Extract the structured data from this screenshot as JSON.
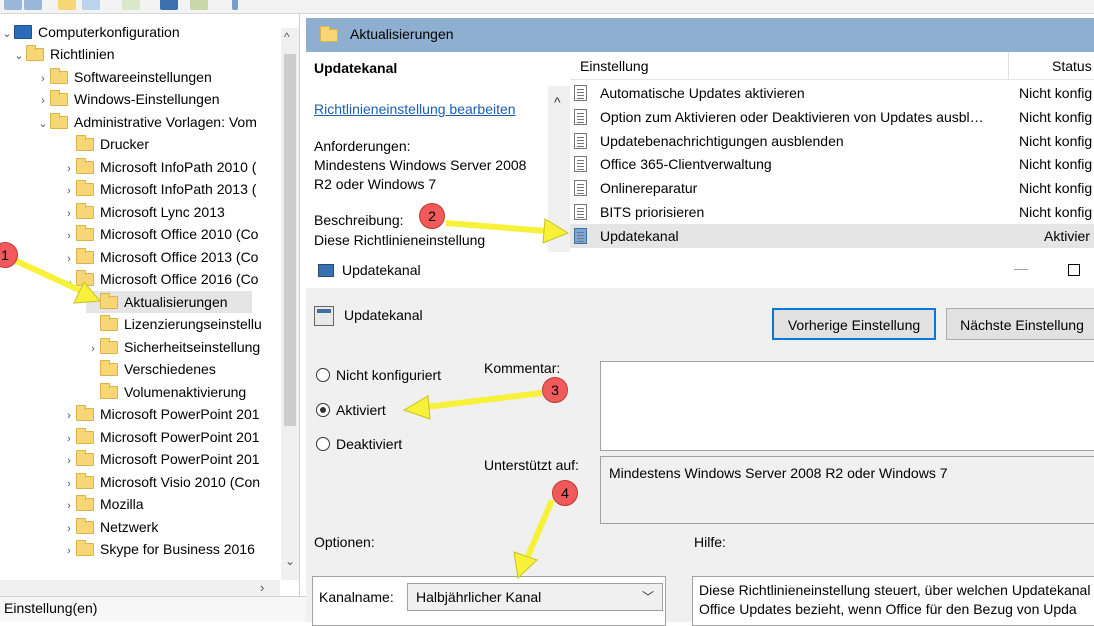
{
  "tree": {
    "items": [
      {
        "label": "Computerkonfiguration",
        "chev": "⌄"
      },
      {
        "label": "Richtlinien",
        "chev": "⌄"
      },
      {
        "label": "Softwareeinstellungen",
        "chev": "›"
      },
      {
        "label": "Windows-Einstellungen",
        "chev": "›"
      },
      {
        "label": "Administrative Vorlagen: Vom",
        "chev": "⌄"
      },
      {
        "label": "Drucker",
        "chev": ""
      },
      {
        "label": "Microsoft InfoPath 2010 (",
        "chev": "›"
      },
      {
        "label": "Microsoft InfoPath 2013 (",
        "chev": "›"
      },
      {
        "label": "Microsoft Lync 2013",
        "chev": "›"
      },
      {
        "label": "Microsoft Office 2010 (Co",
        "chev": "›"
      },
      {
        "label": "Microsoft Office 2013 (Co",
        "chev": "›"
      },
      {
        "label": "Microsoft Office 2016 (Co",
        "chev": "⌄"
      },
      {
        "label": "Aktualisierungen",
        "chev": ""
      },
      {
        "label": "Lizenzierungseinstellu",
        "chev": ""
      },
      {
        "label": "Sicherheitseinstellung",
        "chev": "›"
      },
      {
        "label": "Verschiedenes",
        "chev": ""
      },
      {
        "label": "Volumenaktivierung",
        "chev": ""
      },
      {
        "label": "Microsoft PowerPoint 201",
        "chev": "›"
      },
      {
        "label": "Microsoft PowerPoint 201",
        "chev": "›"
      },
      {
        "label": "Microsoft PowerPoint 201",
        "chev": "›"
      },
      {
        "label": "Microsoft Visio 2010 (Con",
        "chev": "›"
      },
      {
        "label": "Mozilla",
        "chev": "›"
      },
      {
        "label": "Netzwerk",
        "chev": "›"
      },
      {
        "label": "Skype for Business 2016",
        "chev": "›"
      }
    ],
    "scroll_up": "^",
    "scroll_down": "⌄",
    "scroll_right": "›"
  },
  "statusbar": {
    "text": "Einstellung(en)"
  },
  "detail": {
    "header_title": "Aktualisierungen",
    "desc_title": "Updatekanal",
    "desc_link": "Richtlinieneinstellung bearbeiten",
    "req_label": "Anforderungen:",
    "req_text": "Mindestens Windows Server 2008 R2 oder Windows 7",
    "beschr_label": "Beschreibung:",
    "beschr_text": "Diese Richtlinieneinstellung",
    "scroll_up": "^"
  },
  "list": {
    "col_setting": "Einstellung",
    "col_status": "Status",
    "rows": [
      {
        "name": "Automatische Updates aktivieren",
        "status": "Nicht konfig"
      },
      {
        "name": "Option zum Aktivieren oder Deaktivieren von Updates ausbl…",
        "status": "Nicht konfig"
      },
      {
        "name": "Updatebenachrichtigungen ausblenden",
        "status": "Nicht konfig"
      },
      {
        "name": "Office 365-Clientverwaltung",
        "status": "Nicht konfig"
      },
      {
        "name": "Onlinereparatur",
        "status": "Nicht konfig"
      },
      {
        "name": "BITS priorisieren",
        "status": "Nicht konfig"
      },
      {
        "name": "Updatekanal",
        "status": "Aktivier"
      }
    ]
  },
  "dialog": {
    "title": "Updatekanal",
    "minimize": "—",
    "setting_name": "Updatekanal",
    "btn_prev": "Vorherige Einstellung",
    "btn_next": "Nächste Einstellung",
    "radio_not_configured": "Nicht konfiguriert",
    "radio_enabled": "Aktiviert",
    "radio_disabled": "Deaktiviert",
    "kommentar_label": "Kommentar:",
    "unterstuetzt_label": "Unterstützt auf:",
    "unterstuetzt_text": "Mindestens Windows Server 2008 R2 oder Windows 7",
    "optionen_label": "Optionen:",
    "hilfe_label": "Hilfe:",
    "kanal_label": "Kanalname:",
    "kanal_value": "Halbjährlicher Kanal",
    "kanal_chevron": "﹀",
    "help_line1": "Diese Richtlinieneinstellung steuert, über welchen Updatekanal",
    "help_line2": "Office Updates bezieht, wenn Office für den Bezug von Upda"
  },
  "annotations": [
    "1",
    "2",
    "3",
    "4"
  ],
  "colors": {
    "arrow": "#f7f13a",
    "badge": "#f05a5a",
    "header": "#8fafd1",
    "accent": "#0078d7"
  }
}
